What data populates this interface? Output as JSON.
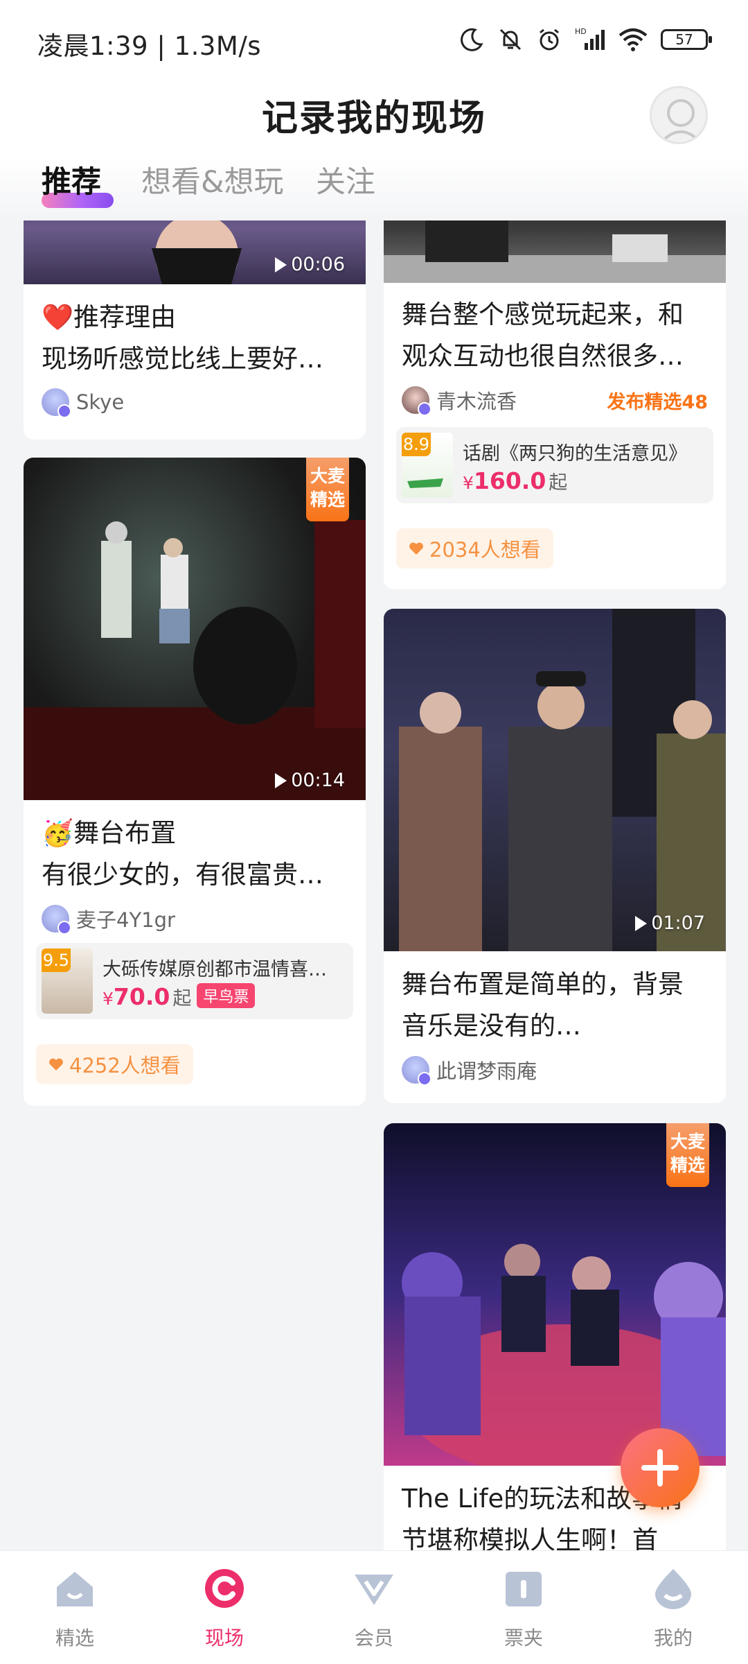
{
  "status_bar": {
    "time": "凌晨1:39 | 1.3M/s",
    "battery": "57",
    "icons": [
      "moon-icon",
      "bell-off-icon",
      "alarm-icon",
      "hd-signal-icon",
      "wifi-icon",
      "battery-icon"
    ]
  },
  "header": {
    "title": "记录我的现场"
  },
  "tabs": [
    {
      "label": "推荐",
      "active": true
    },
    {
      "label": "想看&想玩",
      "active": false
    },
    {
      "label": "关注",
      "active": false
    }
  ],
  "feed": {
    "col1": [
      {
        "duration": "00:06",
        "text_line1": "推荐理由",
        "text_line2": "现场听感觉比线上要好…",
        "user": "Skye"
      },
      {
        "badge": "大麦精选",
        "badge_line1": "大麦",
        "badge_line2": "精选",
        "duration": "00:14",
        "text_line1": "舞台布置",
        "text_line2": "有很少女的，有很富贵…",
        "user": "麦子4Y1gr",
        "show": {
          "score": "9.5",
          "title": "大砾传媒原创都市温情喜…",
          "price_symbol": "¥",
          "price": "70.0",
          "price_suffix": "起",
          "tag": "早鸟票"
        },
        "want": "4252人想看"
      }
    ],
    "col2": [
      {
        "text_line1": "舞台整个感觉玩起来，和",
        "text_line2": "观众互动也很自然很多…",
        "user": "青木流香",
        "pub_tag": "发布精选48",
        "show": {
          "score": "8.9",
          "title": "话剧《两只狗的生活意见》",
          "price_symbol": "¥",
          "price": "160.0",
          "price_suffix": "起"
        },
        "want": "2034人想看"
      },
      {
        "duration": "01:07",
        "text_line1": "舞台布置是简单的，背景",
        "text_line2": "音乐是没有的…",
        "user": "此谓梦雨庵"
      },
      {
        "badge_line1": "大麦",
        "badge_line2": "精选",
        "text_line1": "The Life的玩法和故事情",
        "text_line2": "节堪称模拟人生啊！首"
      }
    ]
  },
  "bottom_nav": [
    {
      "label": "精选",
      "icon": "home-icon",
      "active": false
    },
    {
      "label": "现场",
      "icon": "live-icon",
      "active": true
    },
    {
      "label": "会员",
      "icon": "vip-icon",
      "active": false
    },
    {
      "label": "票夹",
      "icon": "ticket-icon",
      "active": false
    },
    {
      "label": "我的",
      "icon": "profile-icon",
      "active": false
    }
  ],
  "colors": {
    "accent": "#ec2e6a",
    "orange": "#f97316",
    "want_bg": "#fff3e8"
  }
}
